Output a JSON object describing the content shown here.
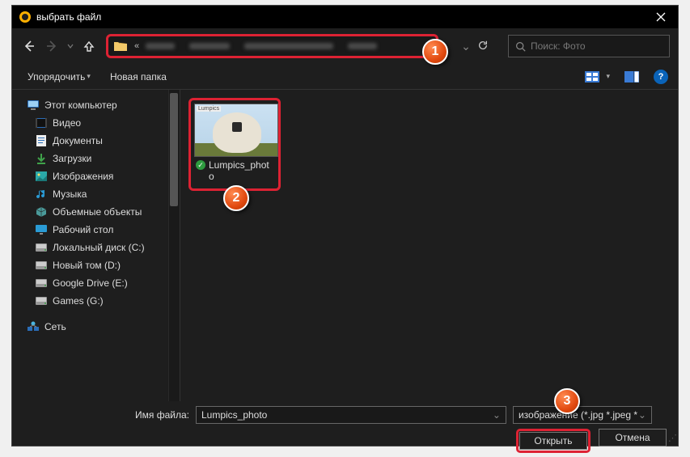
{
  "window": {
    "title": "выбрать файл"
  },
  "search": {
    "placeholder": "Поиск: Фото"
  },
  "toolbar": {
    "organize": "Упорядочить",
    "new_folder": "Новая папка"
  },
  "sidebar": {
    "root": "Этот компьютер",
    "items": [
      "Видео",
      "Документы",
      "Загрузки",
      "Изображения",
      "Музыка",
      "Объемные объекты",
      "Рабочий стол",
      "Локальный диск (C:)",
      "Новый том (D:)",
      "Google Drive (E:)",
      "Games (G:)"
    ],
    "network": "Сеть"
  },
  "file": {
    "thumb_label": "Lumpics_photo",
    "thumb_tag": "Lumpics"
  },
  "footer": {
    "filename_label": "Имя файла:",
    "filename_value": "Lumpics_photo",
    "filetype_value": "изображение (*.jpg *.jpeg *.png)",
    "open": "Открыть",
    "cancel": "Отмена"
  },
  "annotations": {
    "b1": "1",
    "b2": "2",
    "b3": "3"
  }
}
